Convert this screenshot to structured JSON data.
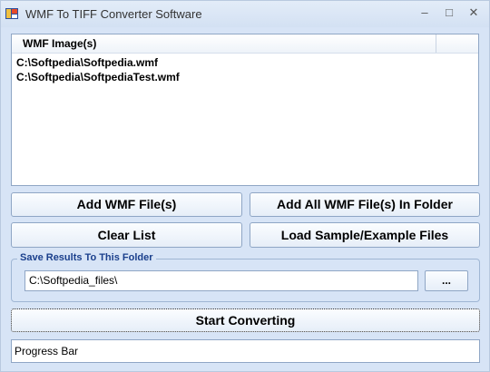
{
  "window": {
    "title": "WMF To TIFF Converter Software",
    "minimize_glyph": "–",
    "maximize_glyph": "□",
    "close_glyph": "✕"
  },
  "file_list": {
    "column_header": "WMF Image(s)",
    "items": [
      "C:\\Softpedia\\Softpedia.wmf",
      "C:\\Softpedia\\SoftpediaTest.wmf"
    ]
  },
  "buttons": {
    "add_files": "Add WMF File(s)",
    "add_all_in_folder": "Add All WMF File(s) In Folder",
    "clear_list": "Clear List",
    "load_samples": "Load Sample/Example Files",
    "start_converting": "Start Converting"
  },
  "output": {
    "group_label": "Save Results To This Folder",
    "folder_value": "C:\\Softpedia_files\\",
    "browse_label": "..."
  },
  "progress": {
    "label": "Progress Bar",
    "value_percent": 0
  },
  "colors": {
    "window_bg": "#d7e4f6",
    "group_label": "#1a3f8c",
    "border": "#8fa6c5"
  },
  "icons": {
    "app": "app-icon"
  }
}
